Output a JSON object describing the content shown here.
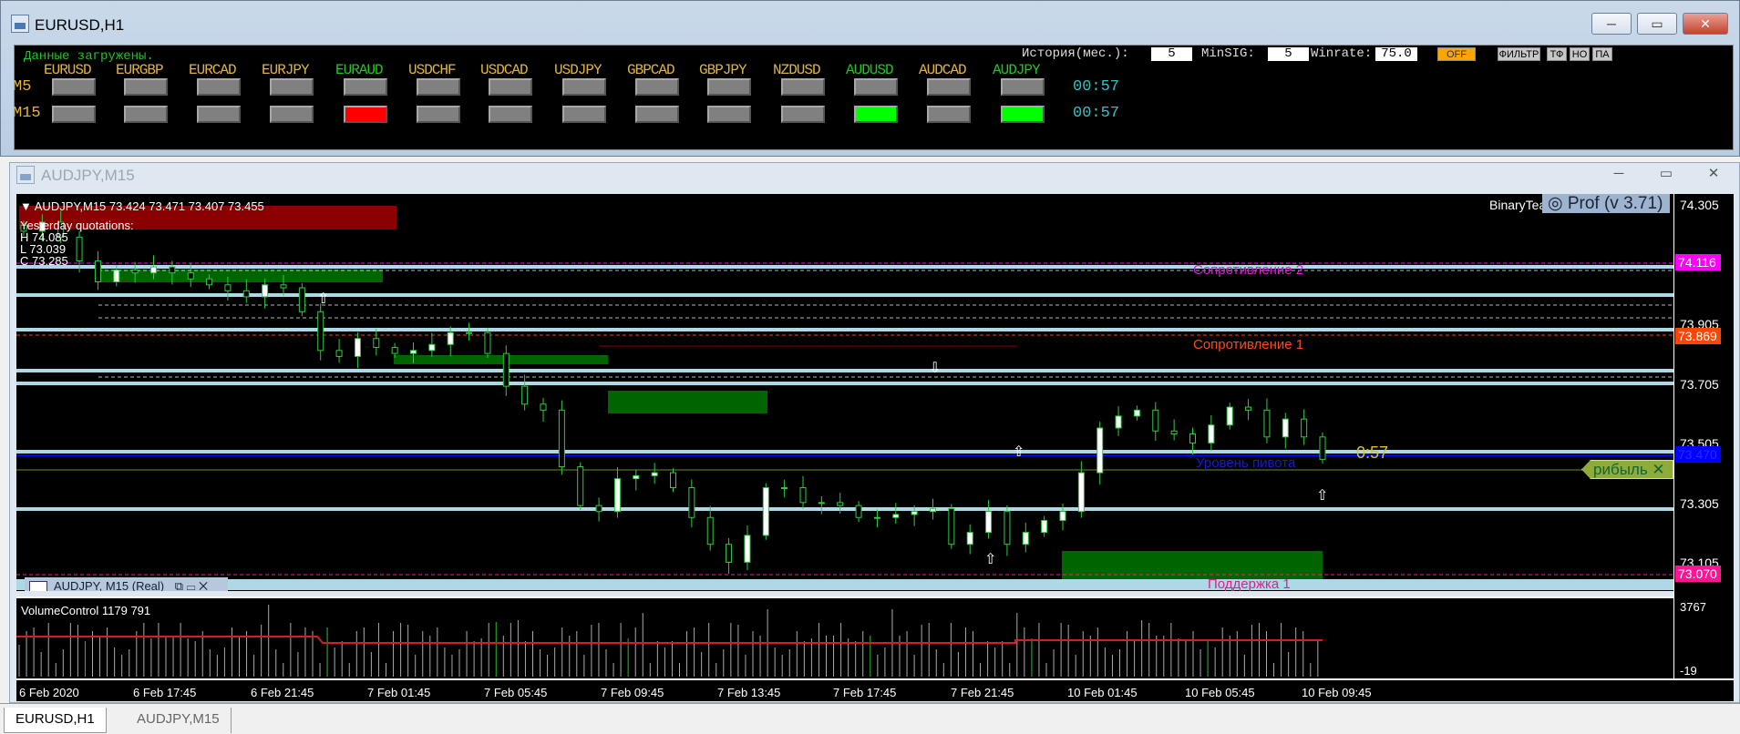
{
  "window1": {
    "title": "EURUSD,H1",
    "buttons": [
      "─",
      "▭",
      "✕"
    ]
  },
  "panel": {
    "status": "Данные загружены.",
    "history_label": "История(мес.):",
    "history_value": "5",
    "minsig_label": "MinSIG:",
    "minsig_value": "5",
    "winrate_label": "Winrate:",
    "winrate_value": "75.0",
    "off_label": "OFF",
    "filter_label": "ФИЛЬТР",
    "tf_label": "ТФ",
    "no_label": "НО",
    "pa_label": "ПА",
    "pairs": [
      {
        "name": "EURUSD",
        "active": false
      },
      {
        "name": "EURGBP",
        "active": false
      },
      {
        "name": "EURCAD",
        "active": false
      },
      {
        "name": "EURJPY",
        "active": false
      },
      {
        "name": "EURAUD",
        "active": true
      },
      {
        "name": "USDCHF",
        "active": false
      },
      {
        "name": "USDCAD",
        "active": false
      },
      {
        "name": "USDJPY",
        "active": false
      },
      {
        "name": "GBPCAD",
        "active": false
      },
      {
        "name": "GBPJPY",
        "active": false
      },
      {
        "name": "NZDUSD",
        "active": false
      },
      {
        "name": "AUDUSD",
        "active": true
      },
      {
        "name": "AUDCAD",
        "active": false
      },
      {
        "name": "AUDJPY",
        "active": true
      }
    ],
    "rows": [
      {
        "label": "M5",
        "timer": "00:57",
        "signals": [
          "none",
          "none",
          "none",
          "none",
          "none",
          "none",
          "none",
          "none",
          "none",
          "none",
          "none",
          "none",
          "none",
          "none"
        ]
      },
      {
        "label": "M15",
        "timer": "00:57",
        "signals": [
          "none",
          "none",
          "none",
          "none",
          "sell",
          "none",
          "none",
          "none",
          "none",
          "none",
          "none",
          "buy",
          "none",
          "buy"
        ]
      }
    ],
    "colors": {
      "pair": "#e0b43c",
      "pair_active": "#22c322",
      "none": "#808080",
      "sell": "#ff0000",
      "buy": "#00ff00"
    }
  },
  "window2": {
    "title": "AUDJPY,M15",
    "buttons": [
      "─",
      "▭",
      "✕"
    ]
  },
  "chart": {
    "header": "AUDJPY,M15  73.424 73.471 73.407 73.455",
    "yesterday": {
      "title": "Yesterday quotations:",
      "h": "H 74.085",
      "l": "L 73.039",
      "c": "C 73.285"
    },
    "brand": "BinaryTea",
    "brand_badge": "Prof (v 3.71)",
    "levels": {
      "r2": "Сопротивление 2",
      "r1": "Сопротивление 1",
      "pivot": "Уровень пивота",
      "s1": "Поддержка 1"
    },
    "countdown": "0:57",
    "profit_tag": "рибыль",
    "profit_close": "✕",
    "price_tags": [
      {
        "value": "74.116",
        "color": "#ff00ff"
      },
      {
        "value": "73.869",
        "color": "#ff4500"
      },
      {
        "value": "73.470",
        "color": "#0000ff"
      },
      {
        "value": "73.070",
        "color": "#ff1493"
      }
    ],
    "mini_toolbar": "AUDJPY, M15 (Real)",
    "volume_label": "VolumeControl 1179 791",
    "volume_axis": [
      "3767",
      "-19"
    ]
  },
  "chart_data": {
    "type": "candlestick",
    "symbol": "AUDJPY",
    "timeframe": "M15",
    "ylim": [
      73.05,
      74.33
    ],
    "yticks": [
      "74.305",
      "73.905",
      "73.705",
      "73.505",
      "73.305",
      "73.105"
    ],
    "xticks": [
      "6 Feb 2020",
      "6 Feb 17:45",
      "6 Feb 21:45",
      "7 Feb 01:45",
      "7 Feb 05:45",
      "7 Feb 09:45",
      "7 Feb 13:45",
      "7 Feb 17:45",
      "7 Feb 21:45",
      "10 Feb 01:45",
      "10 Feb 05:45",
      "10 Feb 09:45"
    ],
    "closes": [
      74.22,
      74.25,
      74.2,
      74.12,
      74.05,
      74.09,
      74.08,
      74.1,
      74.08,
      74.06,
      74.04,
      74.02,
      74.0,
      74.04,
      74.03,
      73.95,
      73.82,
      73.8,
      73.86,
      73.83,
      73.81,
      73.82,
      73.84,
      73.88,
      73.88,
      73.81,
      73.7,
      73.64,
      73.62,
      73.43,
      73.3,
      73.28,
      73.39,
      73.4,
      73.41,
      73.36,
      73.26,
      73.17,
      73.11,
      73.2,
      73.36,
      73.36,
      73.31,
      73.31,
      73.3,
      73.26,
      73.26,
      73.27,
      73.28,
      73.29,
      73.17,
      73.21,
      73.28,
      73.17,
      73.21,
      73.25,
      73.28,
      73.41,
      73.56,
      73.6,
      73.62,
      73.55,
      73.54,
      73.51,
      73.57,
      73.63,
      73.62,
      73.53,
      73.59,
      73.53,
      73.455
    ]
  }
}
